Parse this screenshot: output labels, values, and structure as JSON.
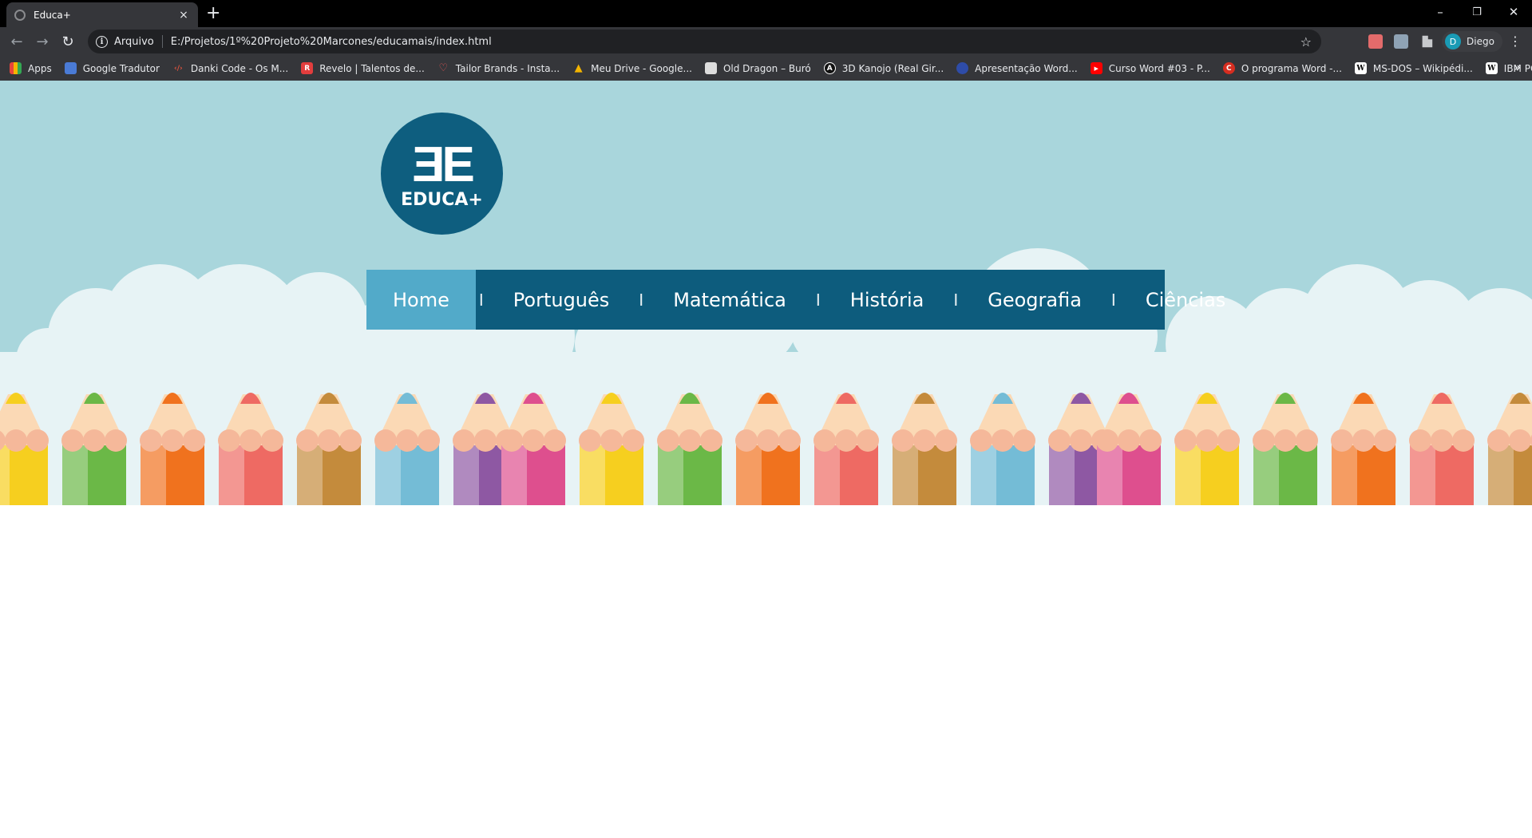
{
  "browser": {
    "tab_title": "Educa+",
    "tab_close": "×",
    "new_tab": "+",
    "window_controls": {
      "minimize": "–",
      "restore": "❐",
      "close": "✕"
    },
    "nav": {
      "back": "←",
      "forward": "→",
      "reload": "↻"
    },
    "omnibox": {
      "info": "i",
      "label": "Arquivo",
      "url": "E:/Projetos/1º%20Projeto%20Marcones/educamais/index.html",
      "star": "☆"
    },
    "profile_initial": "D",
    "profile_name": "Diego",
    "menu": "⋮",
    "bookmarks": [
      {
        "label": "Apps",
        "color": "#e8453c"
      },
      {
        "label": "Google Tradutor",
        "color": "#4a7bd6"
      },
      {
        "label": "Danki Code - Os M...",
        "color": "#c0392b"
      },
      {
        "label": "Revelo | Talentos de...",
        "color": "#e23d3d"
      },
      {
        "label": "Tailor Brands - Insta...",
        "color": "#d64545"
      },
      {
        "label": "Meu Drive - Google...",
        "color": "#f3b400"
      },
      {
        "label": "Old Dragon – Buró",
        "color": "#dddddd"
      },
      {
        "label": "3D Kanojo (Real Gir...",
        "color": "#111111"
      },
      {
        "label": "Apresentação Word...",
        "color": "#2e4ca8"
      },
      {
        "label": "Curso Word #03 - P...",
        "color": "#ff0000"
      },
      {
        "label": "O programa Word -...",
        "color": "#d62d20"
      },
      {
        "label": "MS-DOS – Wikipédi...",
        "color": "#ffffff"
      },
      {
        "label": "IBM PC – Wikipédia...",
        "color": "#ffffff"
      }
    ],
    "bookmarks_more": "»"
  },
  "site": {
    "logo_mark": "ƎE",
    "logo_text": "EDUCA+",
    "menu": [
      {
        "label": "Home",
        "active": true
      },
      {
        "label": "Português",
        "active": false
      },
      {
        "label": "Matemática",
        "active": false
      },
      {
        "label": "História",
        "active": false
      },
      {
        "label": "Geografia",
        "active": false
      },
      {
        "label": "Ciências",
        "active": false
      }
    ],
    "menu_separator": "I",
    "colors": {
      "sky": "#a9d6dc",
      "cloud": "#e7f3f5",
      "brand": "#0d5c7d",
      "menu_active": "#52aac9"
    },
    "pencil_colors": [
      "#f6cf1f",
      "#6bb847",
      "#f0721e",
      "#ee6a63",
      "#c48b3c",
      "#74bcd6",
      "#8e58a3",
      "#de4f8e"
    ]
  }
}
